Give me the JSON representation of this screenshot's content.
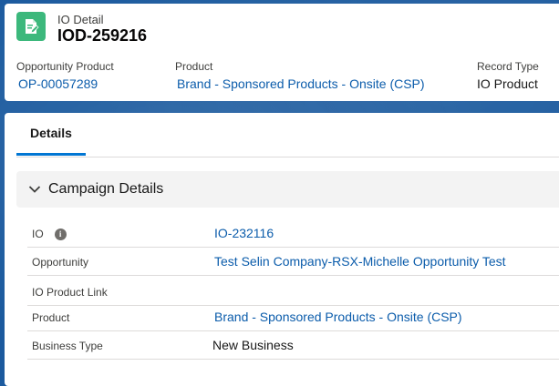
{
  "header": {
    "object_label": "IO Detail",
    "record_title": "IOD-259216",
    "highlights": [
      {
        "label": "Opportunity Product",
        "value": "OP-00057289",
        "is_link": true
      },
      {
        "label": "Product",
        "value": "Brand - Sponsored Products - Onsite (CSP)",
        "is_link": true
      },
      {
        "label": "Record Type",
        "value": "IO Product",
        "is_link": false
      }
    ],
    "icon": "document-edit-icon",
    "icon_color": "#3cb87c"
  },
  "tabs": [
    {
      "label": "Details",
      "active": true
    }
  ],
  "section": {
    "title": "Campaign Details",
    "expanded": true,
    "fields": [
      {
        "label": "IO",
        "value": "IO-232116",
        "is_link": true,
        "has_info": true
      },
      {
        "label": "Opportunity",
        "value": "Test Selin Company-RSX-Michelle Opportunity Test",
        "is_link": true
      },
      {
        "label": "IO Product Link",
        "value": "",
        "is_link": false
      },
      {
        "label": "Product",
        "value": "Brand - Sponsored Products - Onsite (CSP)",
        "is_link": true
      },
      {
        "label": "Business Type",
        "value": "New Business",
        "is_link": false
      }
    ]
  },
  "colors": {
    "link": "#0b5cab",
    "accent": "#0176d3",
    "background": "#1b5a9e"
  }
}
